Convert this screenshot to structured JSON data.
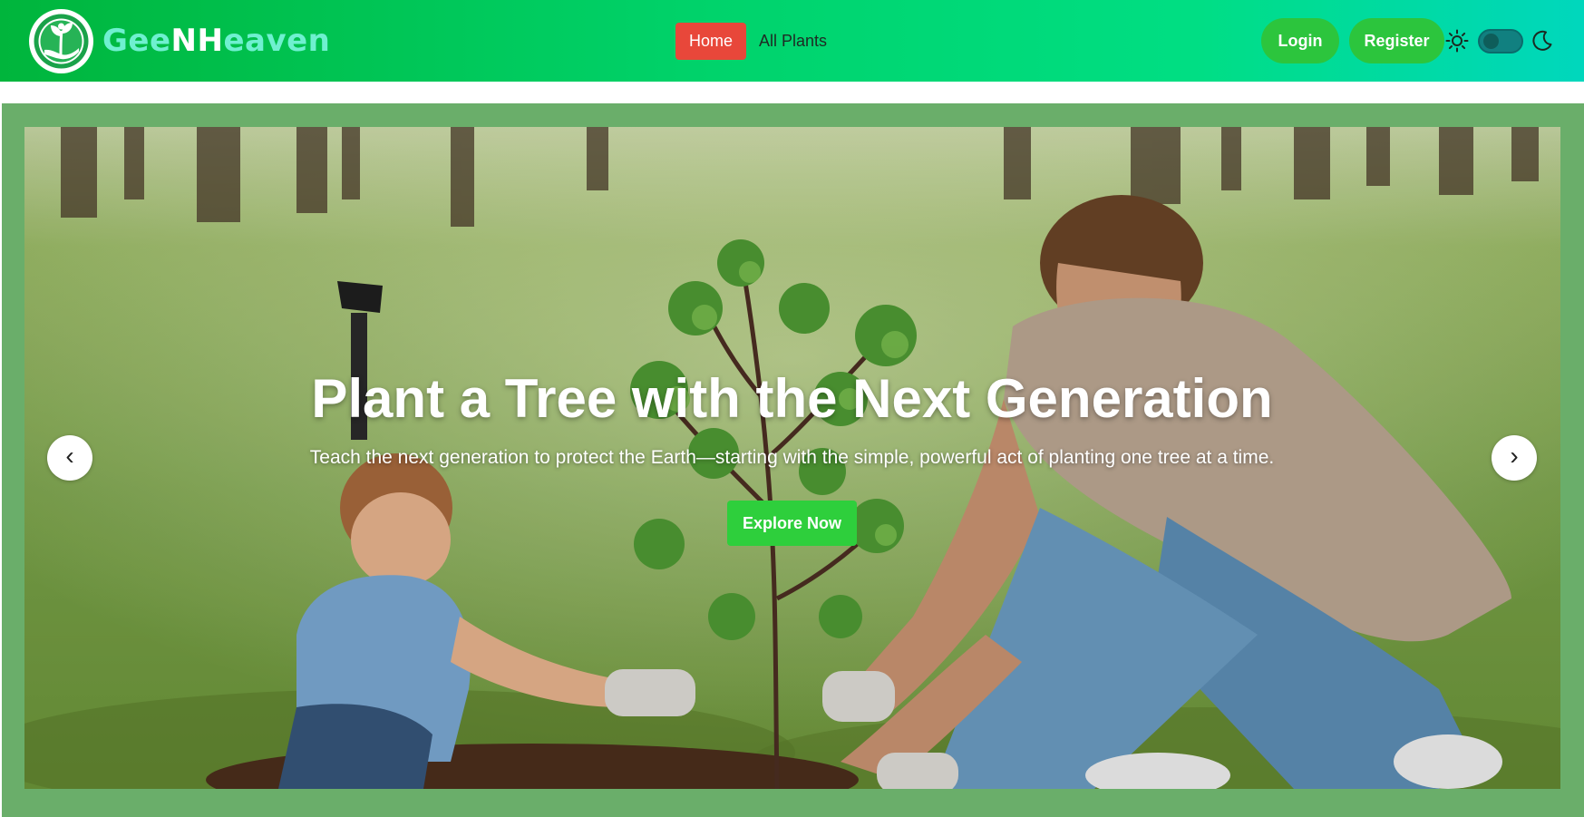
{
  "brand": {
    "part1": "Gee",
    "part2": "NH",
    "part3": "eaven",
    "logo_icon": "hand-holding-plant-icon"
  },
  "nav": {
    "home_label": "Home",
    "all_plants_label": "All Plants"
  },
  "auth": {
    "login_label": "Login",
    "register_label": "Register"
  },
  "theme": {
    "light_icon": "sun-icon",
    "dark_icon": "moon-icon",
    "toggle_state": "off"
  },
  "hero": {
    "title": "Plant a Tree with the Next Generation",
    "subtitle": "Teach the next generation to protect the Earth—starting with the simple, powerful act of planting one tree at a time.",
    "cta_label": "Explore Now",
    "prev_label": "‹",
    "next_label": "›",
    "image": "father-and-son-planting-tree-photo"
  },
  "colors": {
    "nav_gradient_start": "#00b53c",
    "nav_gradient_end": "#00d7bd",
    "home_active": "#e8473a",
    "auth_button": "#2cc53d",
    "cta": "#2ecf3c",
    "hero_frame": "#6aae6a"
  }
}
